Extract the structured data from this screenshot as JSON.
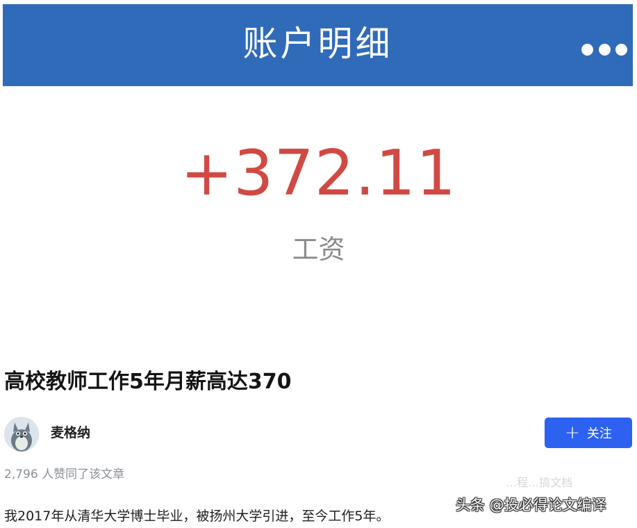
{
  "header": {
    "title": "账户明细"
  },
  "transaction": {
    "amount": "+372.11",
    "label": "工资",
    "amount_color": "#d04a43"
  },
  "article": {
    "title": "高校教师工作5年月薪高达370",
    "author": "麦格纳",
    "follow_label": "关注",
    "likes": "2,796 人赞同了该文章",
    "body": "我2017年从清华大学博士毕业，被扬州大学引进，至今工作5年。"
  },
  "watermark": {
    "main": "头条 @投必得论文编译",
    "faint": "…程…搞文档"
  },
  "colors": {
    "header_bg": "#2f6bb8",
    "follow_bg": "#2d62f0"
  },
  "icons": {
    "more": "more-dots-icon",
    "plus": "plus-icon",
    "avatar": "avatar-image"
  }
}
